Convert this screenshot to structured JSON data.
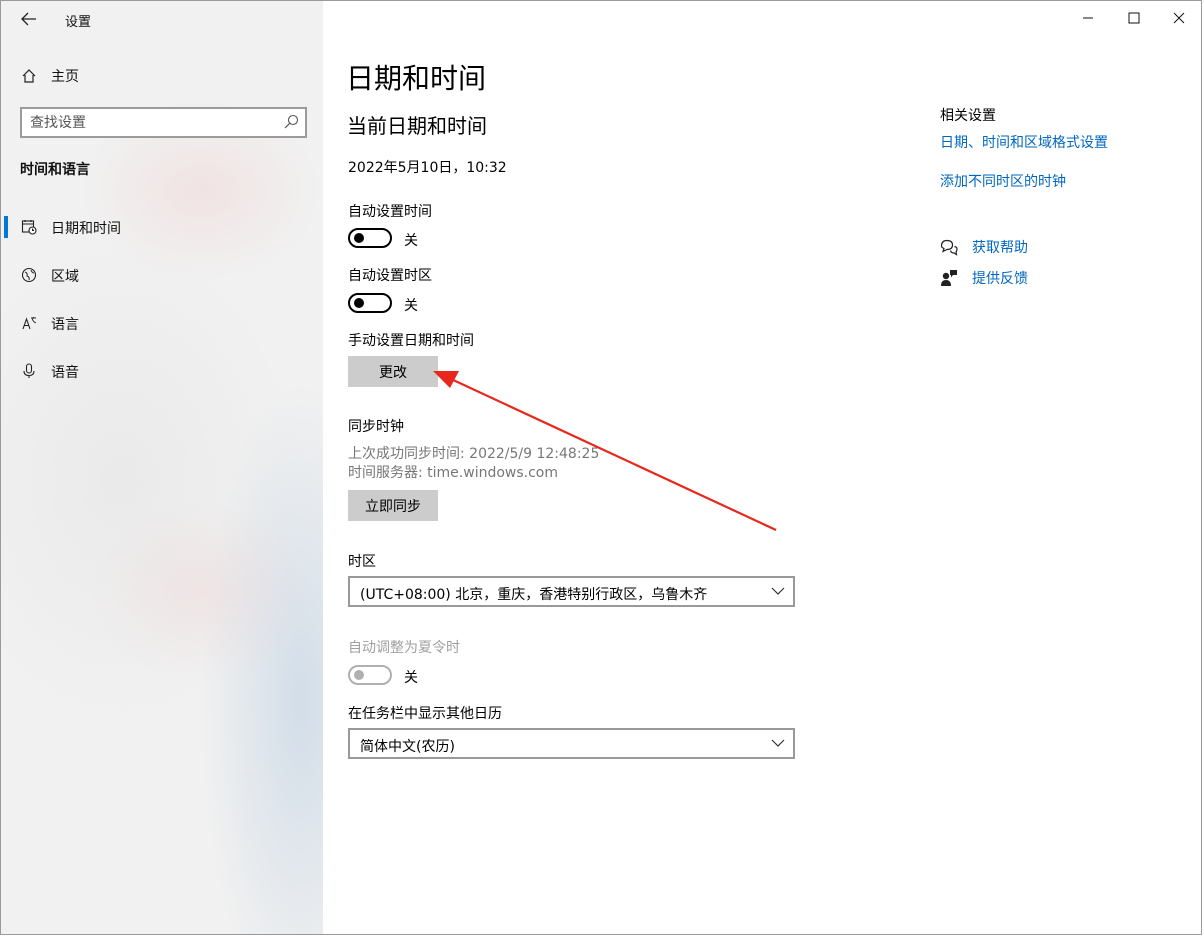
{
  "app": {
    "title": "设置"
  },
  "sidebar": {
    "home_label": "主页",
    "search_placeholder": "查找设置",
    "section_label": "时间和语言",
    "items": [
      {
        "label": "日期和时间",
        "icon": "calendar-clock-icon",
        "active": true
      },
      {
        "label": "区域",
        "icon": "globe-icon",
        "active": false
      },
      {
        "label": "语言",
        "icon": "language-icon",
        "active": false
      },
      {
        "label": "语音",
        "icon": "microphone-icon",
        "active": false
      }
    ]
  },
  "main": {
    "page_title": "日期和时间",
    "current_heading": "当前日期和时间",
    "current_datetime": "2022年5月10日，10:32",
    "auto_time": {
      "label": "自动设置时间",
      "state": "关",
      "on": false
    },
    "auto_timezone": {
      "label": "自动设置时区",
      "state": "关",
      "on": false
    },
    "manual": {
      "label": "手动设置日期和时间",
      "button": "更改"
    },
    "sync": {
      "heading": "同步时钟",
      "last_sync": "上次成功同步时间: 2022/5/9 12:48:25",
      "server": "时间服务器: time.windows.com",
      "button": "立即同步"
    },
    "timezone": {
      "label": "时区",
      "value": "(UTC+08:00) 北京，重庆，香港特别行政区，乌鲁木齐"
    },
    "dst": {
      "label": "自动调整为夏令时",
      "state": "关",
      "enabled": false
    },
    "calendar": {
      "label": "在任务栏中显示其他日历",
      "value": "简体中文(农历)"
    }
  },
  "related": {
    "title": "相关设置",
    "links": [
      "日期、时间和区域格式设置",
      "添加不同时区的时钟"
    ],
    "help": [
      {
        "label": "获取帮助",
        "icon": "help-chat-icon"
      },
      {
        "label": "提供反馈",
        "icon": "feedback-icon"
      }
    ]
  },
  "annotation": {
    "color": "#e8281c",
    "target": "change-button"
  },
  "colors": {
    "accent": "#0078d7",
    "link": "#0067c0",
    "button": "#cccccc"
  }
}
